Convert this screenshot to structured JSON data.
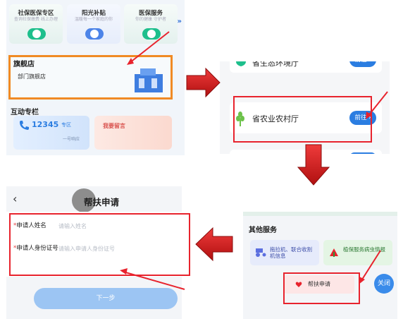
{
  "panel1": {
    "services": [
      {
        "title": "社保医保专区",
        "subtitle": "查询社保缴费 线上办理",
        "icon_color": "#1ebf8c"
      },
      {
        "title": "阳光补贴",
        "subtitle": "温暖每一个家庭的你",
        "icon_color": "#4d84e8"
      },
      {
        "title": "医保服务",
        "subtitle": "你的健康 守护者",
        "icon_color": "#1ebf8c"
      }
    ],
    "more_chevron": "»",
    "flagship_section": "旗舰店",
    "flagship_item": "部门旗舰店",
    "interaction_section": "互动专栏",
    "hotline_number": "12345",
    "hotline_tag": "专区",
    "hotline_sub": "一号响应",
    "message_label": "我要留言"
  },
  "panel2": {
    "departments": [
      {
        "name": "省生态环境厅",
        "button": "前往 ›",
        "icon_color": "#1ebf8c"
      },
      {
        "name": "省农业农村厅",
        "button": "前往 ›",
        "icon_color": "#6cc24a"
      }
    ]
  },
  "panel3": {
    "back": "‹",
    "title": "帮扶申请",
    "fields": [
      {
        "required": "*",
        "label": "申请人姓名",
        "placeholder": "请输入姓名"
      },
      {
        "required": "*",
        "label": "申请人身份证号",
        "placeholder": "请输入申请人身份证号"
      }
    ],
    "next_button": "下一步"
  },
  "panel4": {
    "section_title": "其他服务",
    "services": [
      {
        "label": "拖拉机、联合收割机信息",
        "bg": "#e6ebfb"
      },
      {
        "label": "植保服务病虫情报",
        "bg": "#e4f5e4"
      }
    ],
    "help_button": "帮扶申请",
    "close_button": "关闭"
  },
  "colors": {
    "highlight_red": "#e8232d",
    "orange_box": "#f08a24",
    "primary_blue": "#2b7de1"
  }
}
